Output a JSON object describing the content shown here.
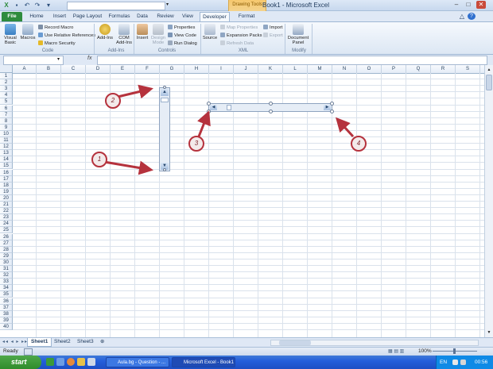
{
  "window": {
    "title": "Book1 - Microsoft Excel",
    "contextual_tab_group": "Drawing Tools"
  },
  "tabs": [
    "File",
    "Home",
    "Insert",
    "Page Layout",
    "Formulas",
    "Data",
    "Review",
    "View",
    "Developer",
    "Format"
  ],
  "ribbon": {
    "code": {
      "label": "Code",
      "visual_basic": "Visual Basic",
      "macros": "Macros",
      "record_macro": "Record Macro",
      "relative_refs": "Use Relative References",
      "macro_security": "Macro Security"
    },
    "addins": {
      "label": "Add-Ins",
      "addins": "Add-Ins",
      "com_addins": "COM Add-Ins"
    },
    "controls": {
      "label": "Controls",
      "insert": "Insert",
      "design_mode": "Design Mode",
      "properties": "Properties",
      "view_code": "View Code",
      "run_dialog": "Run Dialog"
    },
    "xml": {
      "label": "XML",
      "source": "Source",
      "map_properties": "Map Properties",
      "expansion_packs": "Expansion Packs",
      "refresh_data": "Refresh Data",
      "import": "Import",
      "export": "Export"
    },
    "modify": {
      "label": "Modify",
      "document_panel": "Document Panel"
    }
  },
  "formula_bar": {
    "fx": "fx",
    "name_box": "",
    "value": ""
  },
  "columns": [
    "A",
    "B",
    "C",
    "D",
    "E",
    "F",
    "G",
    "H",
    "I",
    "J",
    "K",
    "L",
    "M",
    "N",
    "O",
    "P",
    "Q",
    "R",
    "S"
  ],
  "rows": [
    "1",
    "2",
    "3",
    "4",
    "5",
    "6",
    "7",
    "8",
    "9",
    "10",
    "11",
    "12",
    "13",
    "14",
    "15",
    "16",
    "17",
    "18",
    "19",
    "20",
    "21",
    "22",
    "23",
    "24",
    "25",
    "26",
    "27",
    "28",
    "29",
    "30",
    "31",
    "32",
    "33",
    "34",
    "35",
    "36",
    "37",
    "38",
    "39",
    "40"
  ],
  "sheets": [
    "Sheet1",
    "Sheet2",
    "Sheet3"
  ],
  "status": {
    "text": "Ready",
    "zoom": "100%"
  },
  "taskbar": {
    "start": "start",
    "tasks": [
      "Aula.bg - Question - ...",
      "Microsoft Excel - Book1"
    ],
    "lang": "EN",
    "clock": "00:56"
  },
  "annotations": [
    "1",
    "2",
    "3",
    "4"
  ],
  "accent": "#2e8b3d"
}
